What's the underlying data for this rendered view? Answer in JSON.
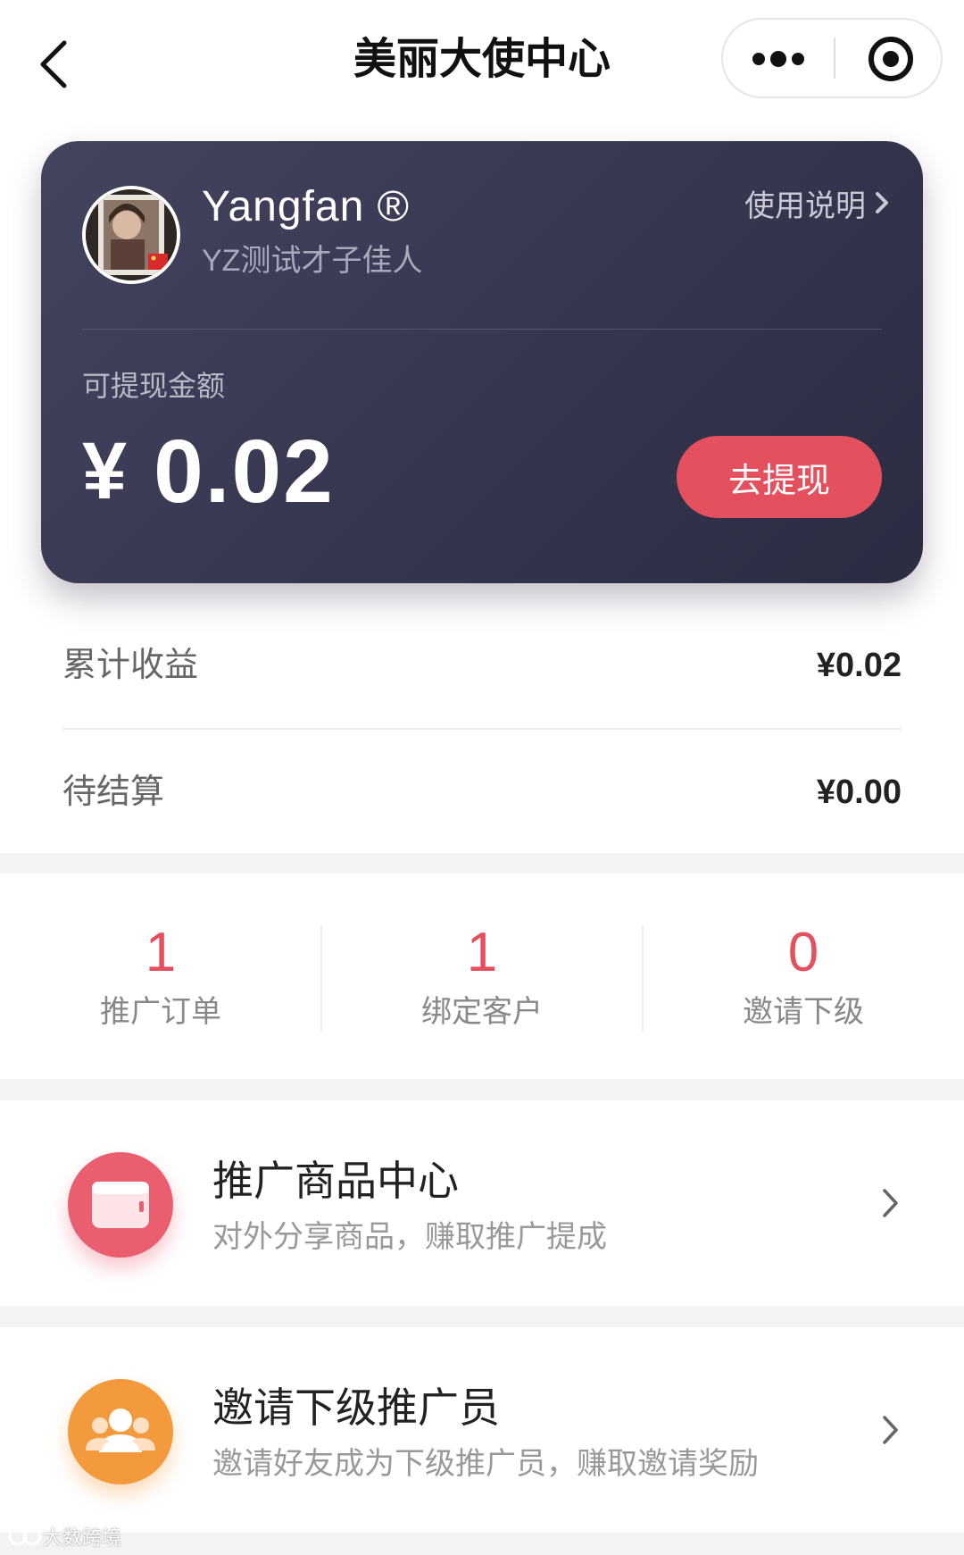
{
  "navbar": {
    "title": "美丽大使中心",
    "back_icon": "chevron-left-icon",
    "more_icon": "more-dots-icon",
    "close_icon": "target-close-icon"
  },
  "card": {
    "username": "Yangfan ®",
    "store_name": "YZ测试才子佳人",
    "help_label": "使用说明",
    "available_label": "可提现金额",
    "currency_symbol": "¥",
    "available_amount": "0.02",
    "withdraw_label": "去提现",
    "colors": {
      "card_bg": "#3a3a55",
      "accent": "#e5505f"
    }
  },
  "summary": [
    {
      "label": "累计收益",
      "value": "¥0.02"
    },
    {
      "label": "待结算",
      "value": "¥0.00"
    }
  ],
  "stats": [
    {
      "value": "1",
      "label": "推广订单"
    },
    {
      "value": "1",
      "label": "绑定客户"
    },
    {
      "value": "0",
      "label": "邀请下级"
    }
  ],
  "menus": [
    {
      "icon": "wallet-icon",
      "color": "#ea5f6f",
      "title": "推广商品中心",
      "subtitle": "对外分享商品，赚取推广提成"
    },
    {
      "icon": "group-users-icon",
      "color": "#f39a3f",
      "title": "邀请下级推广员",
      "subtitle": "邀请好友成为下级推广员，赚取邀请奖励"
    }
  ],
  "watermark": "大数跨境"
}
